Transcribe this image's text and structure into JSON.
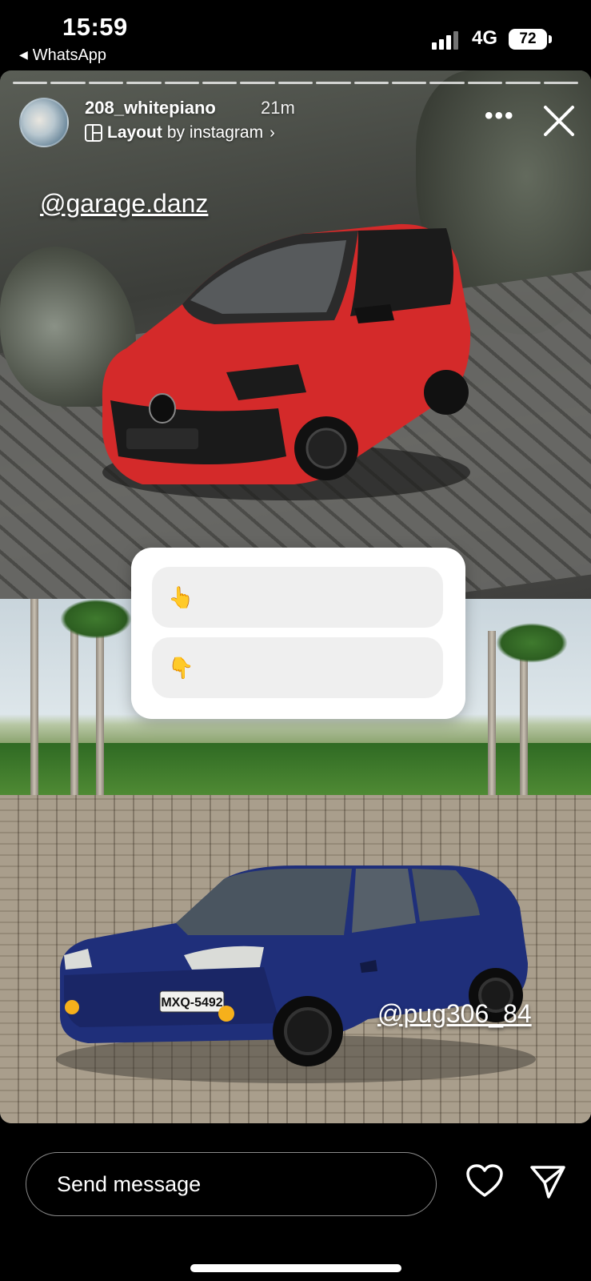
{
  "status_bar": {
    "time": "15:59",
    "back_app": "WhatsApp",
    "network": "4G",
    "battery": "72"
  },
  "story": {
    "username": "208_whitepiano",
    "time_ago": "21m",
    "layout_prefix": "Layout",
    "layout_suffix": "by instagram",
    "more_icon": "more-horizontal-icon",
    "close_icon": "close-icon",
    "progress_segments": 15,
    "mention_top": "@garage.danz",
    "mention_bottom": "@pug306_84",
    "bottom_plate": "MXQ-5492",
    "poll": {
      "option_1": "👆",
      "option_2": "👇"
    }
  },
  "footer": {
    "message_placeholder": "Send message",
    "like_icon": "heart-icon",
    "share_icon": "send-icon"
  },
  "colors": {
    "background": "#000000",
    "red_car": "#d42a2a",
    "blue_car": "#1f2f7a",
    "poll_bg": "#ffffff",
    "poll_option_bg": "#efefef"
  }
}
